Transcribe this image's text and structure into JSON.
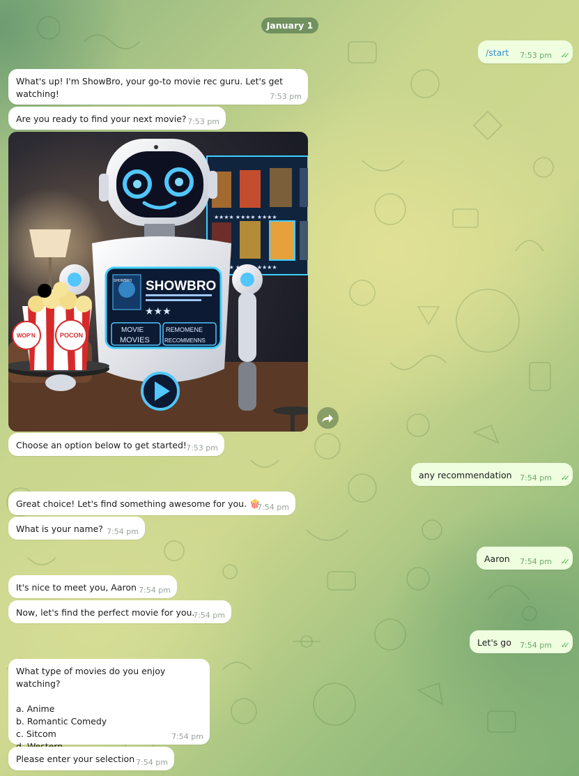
{
  "date_separator": "January 1",
  "messages": {
    "m1": {
      "text": "/start",
      "time": "7:53 pm"
    },
    "m2": {
      "text": "What's up! I'm ShowBro, your go-to movie rec guru. Let's get\nwatching!",
      "time": "7:53 pm"
    },
    "m3": {
      "text": "Are you ready to find your next movie?",
      "time": "7:53 pm"
    },
    "m4": {
      "text": "Choose an option below to get started!",
      "time": "7:53 pm"
    },
    "m5": {
      "text": "any recommendation",
      "time": "7:54 pm"
    },
    "m6": {
      "text": "Great choice! Let's find something awesome for you. 🍿",
      "time": "7:54 pm"
    },
    "m7": {
      "text": "What is your name?",
      "time": "7:54 pm"
    },
    "m8": {
      "text": "Aaron",
      "time": "7:54 pm"
    },
    "m9": {
      "text": "It's nice to meet you, Aaron",
      "time": "7:54 pm"
    },
    "m10": {
      "text": "Now, let's find the perfect movie for you.",
      "time": "7:54 pm"
    },
    "m11": {
      "text": "Let's go",
      "time": "7:54 pm"
    },
    "m12": {
      "text": "What type of movies do you enjoy watching?\n\na. Anime\nb. Romantic Comedy\nc. Sitcom\nd. Western",
      "time": "7:54 pm"
    },
    "m13": {
      "text": "Please enter your selection",
      "time": "7:54 pm"
    }
  },
  "photo": {
    "brand": "SHOWBRO",
    "screen_left_top": "MOVIE",
    "screen_left_bottom": "MOVIES",
    "screen_right_top": "REMOMENE",
    "screen_right_bottom": "RECOMMENNS",
    "popcorn_label_1": "WOP'N",
    "popcorn_label_2": "POCON",
    "poster_text": "SHOWBRO",
    "stars": "★★★"
  },
  "icons": {
    "share": "share-arrow-icon",
    "read": "double-check-icon"
  }
}
